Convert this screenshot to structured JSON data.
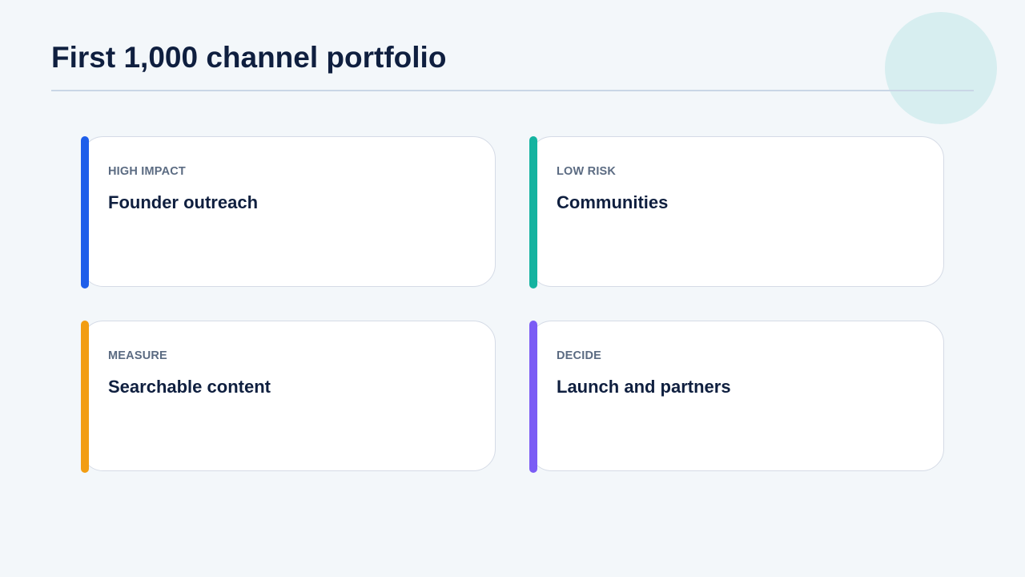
{
  "title": "First 1,000 channel portfolio",
  "cards": [
    {
      "tag": "HIGH IMPACT",
      "heading": "Founder outreach",
      "accent_color": "#1e5eea"
    },
    {
      "tag": "LOW RISK",
      "heading": "Communities",
      "accent_color": "#14b3a0"
    },
    {
      "tag": "MEASURE",
      "heading": "Searchable content",
      "accent_color": "#f29d12"
    },
    {
      "tag": "DECIDE",
      "heading": "Launch and partners",
      "accent_color": "#7b5cf5"
    }
  ]
}
